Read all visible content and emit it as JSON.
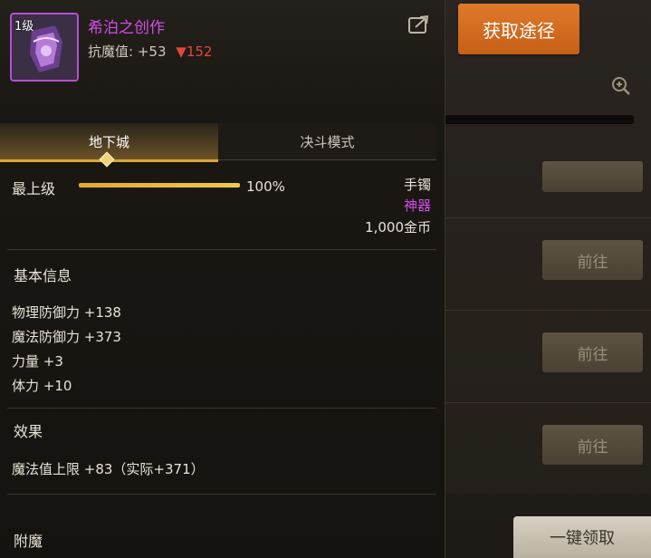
{
  "item": {
    "level": "1级",
    "name": "希泊之创作",
    "stat_label": "抗魔值:",
    "stat_value": "+53",
    "stat_change": "▼152",
    "slot": "手镯",
    "rarity": "神器",
    "price": "1,000金币"
  },
  "tabs": [
    {
      "label": "地下城",
      "active": true
    },
    {
      "label": "决斗模式",
      "active": false
    }
  ],
  "upgrade": {
    "label": "最上级",
    "progress": 1.0,
    "percent_text": "100%"
  },
  "basic_info": {
    "title": "基本信息",
    "stats": [
      "物理防御力 +138",
      "魔法防御力 +373",
      "力量 +3",
      "体力 +10"
    ]
  },
  "effects": {
    "title": "效果",
    "items": [
      "魔法值上限 +83（实际+371）"
    ]
  },
  "enchant": {
    "title": "附魔"
  },
  "side": {
    "get_source_button": "获取途径",
    "go_buttons": [
      "前往",
      "前往",
      "前往"
    ],
    "claim_all_button": "一键领取"
  },
  "colors": {
    "epic_purple": "#d24ee8",
    "accent_orange": "#d96d20",
    "decrease_red": "#e0483a",
    "tab_gold": "#d9a53a"
  },
  "icons": {
    "share": "share-icon",
    "zoom": "zoom-in-icon",
    "item": "bracelet-icon"
  }
}
